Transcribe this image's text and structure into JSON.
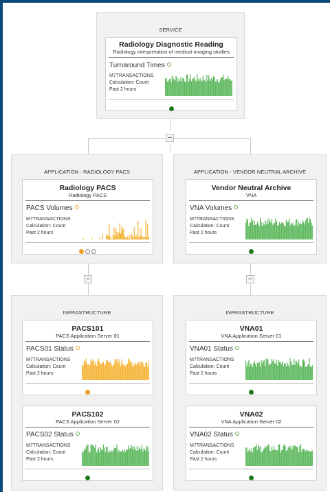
{
  "service": {
    "group_title": "SERVICE",
    "card": {
      "title": "Radiology Diagnostic Reading",
      "subtitle": "Radiology interpretation of medical imaging studies",
      "metric": "Turnaround Times",
      "source": "M7TRANSACTIONS",
      "calc": "Calculation: Count",
      "window": "Past 2 hours",
      "status": "ok"
    }
  },
  "collapse_label": "–",
  "apps": [
    {
      "group_title": "APPLICATION - RADIOLOGY PACS",
      "card": {
        "title": "Radiology PACS",
        "subtitle": "Radiology PACS",
        "metric": "PACS Volumes",
        "source": "M7TRANSACTIONS",
        "calc": "Calculation: Count",
        "window": "Past 2 hours",
        "status": "warn"
      }
    },
    {
      "group_title": "APPLICATION - VENDOR NEUTRAL ARCHIVE",
      "card": {
        "title": "Vendor Neutral Archive",
        "subtitle": "VNA",
        "metric": "VNA Volumes",
        "source": "M7TRANSACTIONS",
        "calc": "Calculation: Count",
        "window": "Past 2 hours",
        "status": "ok"
      }
    }
  ],
  "infra": [
    {
      "group_title": "INFRASTRUCTURE",
      "cards": [
        {
          "title": "PACS101",
          "subtitle": "PACS Application Server 01",
          "metric": "PACS01 Status",
          "source": "M7TRANSACTIONS",
          "calc": "Calculation: Count",
          "window": "Past 2 hours",
          "status": "warn"
        },
        {
          "title": "PACS102",
          "subtitle": "PACS Application Server 02",
          "metric": "PACS02 Status",
          "source": "M7TRANSACTIONS",
          "calc": "Calculation: Count",
          "window": "Past 2 hours",
          "status": "ok"
        }
      ]
    },
    {
      "group_title": "INFRASTRUCTURE",
      "cards": [
        {
          "title": "VNA01",
          "subtitle": "VNA Application Server 01",
          "metric": "VNA01 Status",
          "source": "M7TRANSACTIONS",
          "calc": "Calculation: Count",
          "window": "Past 2 hours",
          "status": "ok"
        },
        {
          "title": "VNA02",
          "subtitle": "VNA Application Server 02",
          "metric": "VNA02 Status",
          "source": "M7TRANSACTIONS",
          "calc": "Calculation: Count",
          "window": "Past 2 hours",
          "status": "ok"
        }
      ]
    }
  ],
  "colors": {
    "ok": "#5cb85c",
    "warn": "#f5b335",
    "status_ok": "#1a7a1a",
    "status_warn": "#f0a020",
    "frame": "#0b4a78"
  }
}
